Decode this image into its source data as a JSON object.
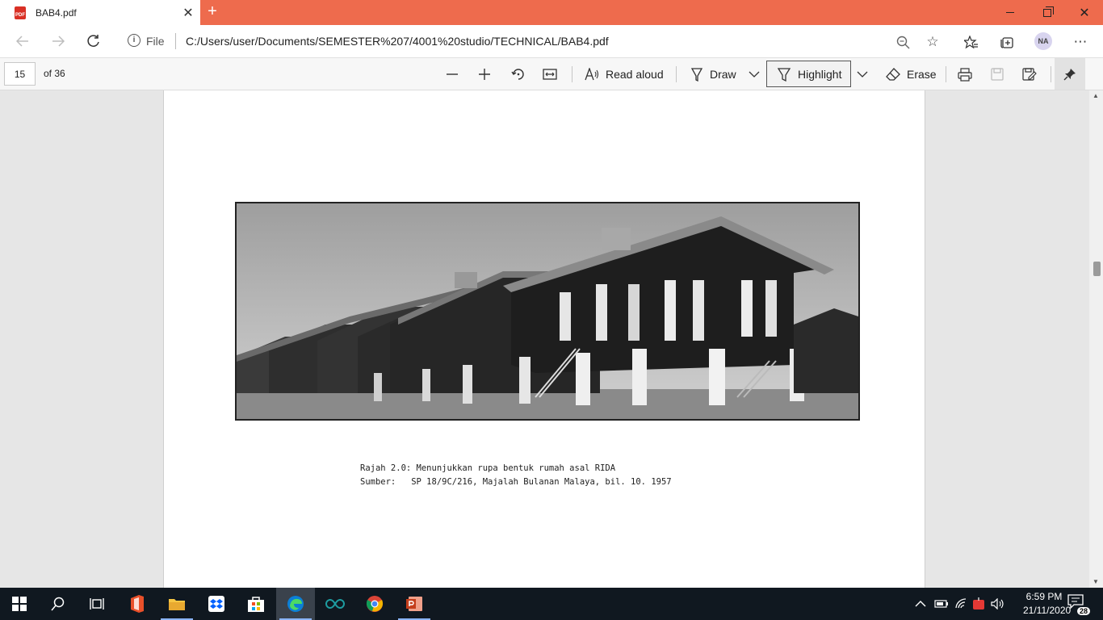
{
  "browser": {
    "tab_title": "BAB4.pdf",
    "file_label": "File",
    "url": "C:/Users/user/Documents/SEMESTER%207/4001%20studio/TECHNICAL/BAB4.pdf",
    "profile_initials": "NA",
    "pdf_badge": "PDF"
  },
  "pdf_toolbar": {
    "page_number": "15",
    "page_total": "of 36",
    "read_aloud": "Read aloud",
    "draw": "Draw",
    "highlight": "Highlight",
    "erase": "Erase"
  },
  "document": {
    "caption_line1": "Rajah 2.0: Menunjukkan rupa bentuk rumah asal RIDA",
    "caption_line2": "Sumber:   SP 18/9C/216, Majalah Bulanan Malaya, bil. 10. 1957"
  },
  "taskbar": {
    "time": "6:59 PM",
    "date": "21/11/2020",
    "notifications": "28"
  },
  "colors": {
    "titlebar": "#ee6b4d",
    "taskbar": "#101820"
  }
}
